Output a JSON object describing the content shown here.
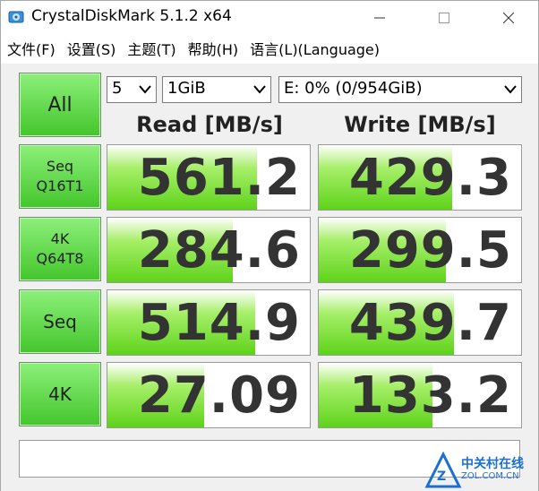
{
  "window": {
    "title": "CrystalDiskMark 5.1.2 x64"
  },
  "menu": [
    "文件(F)",
    "设置(S)",
    "主题(T)",
    "帮助(H)",
    "语言(L)(Language)"
  ],
  "controls": {
    "all_label": "All",
    "count": "5",
    "size": "1GiB",
    "drive": "E: 0% (0/954GiB)"
  },
  "headers": {
    "read": "Read [MB/s]",
    "write": "Write [MB/s]"
  },
  "tests": [
    {
      "line1": "Seq",
      "line2": "Q16T1",
      "read": "561.2",
      "write": "429.3",
      "read_fraction": 0.74,
      "write_fraction": 0.66
    },
    {
      "line1": "4K",
      "line2": "Q64T8",
      "read": "284.6",
      "write": "299.5",
      "read_fraction": 0.62,
      "write_fraction": 0.63
    },
    {
      "line1": "Seq",
      "line2": "",
      "read": "514.9",
      "write": "439.7",
      "read_fraction": 0.73,
      "write_fraction": 0.67
    },
    {
      "line1": "4K",
      "line2": "",
      "read": "27.09",
      "write": "133.2",
      "read_fraction": 0.48,
      "write_fraction": 0.56
    }
  ],
  "watermark": {
    "line1": "中关村在线",
    "line2": "ZOL.COM.CN"
  },
  "colors": {
    "accent_green": "#5ed31a",
    "button_green": "#44c52c",
    "watermark_blue": "#1a6fd6"
  }
}
